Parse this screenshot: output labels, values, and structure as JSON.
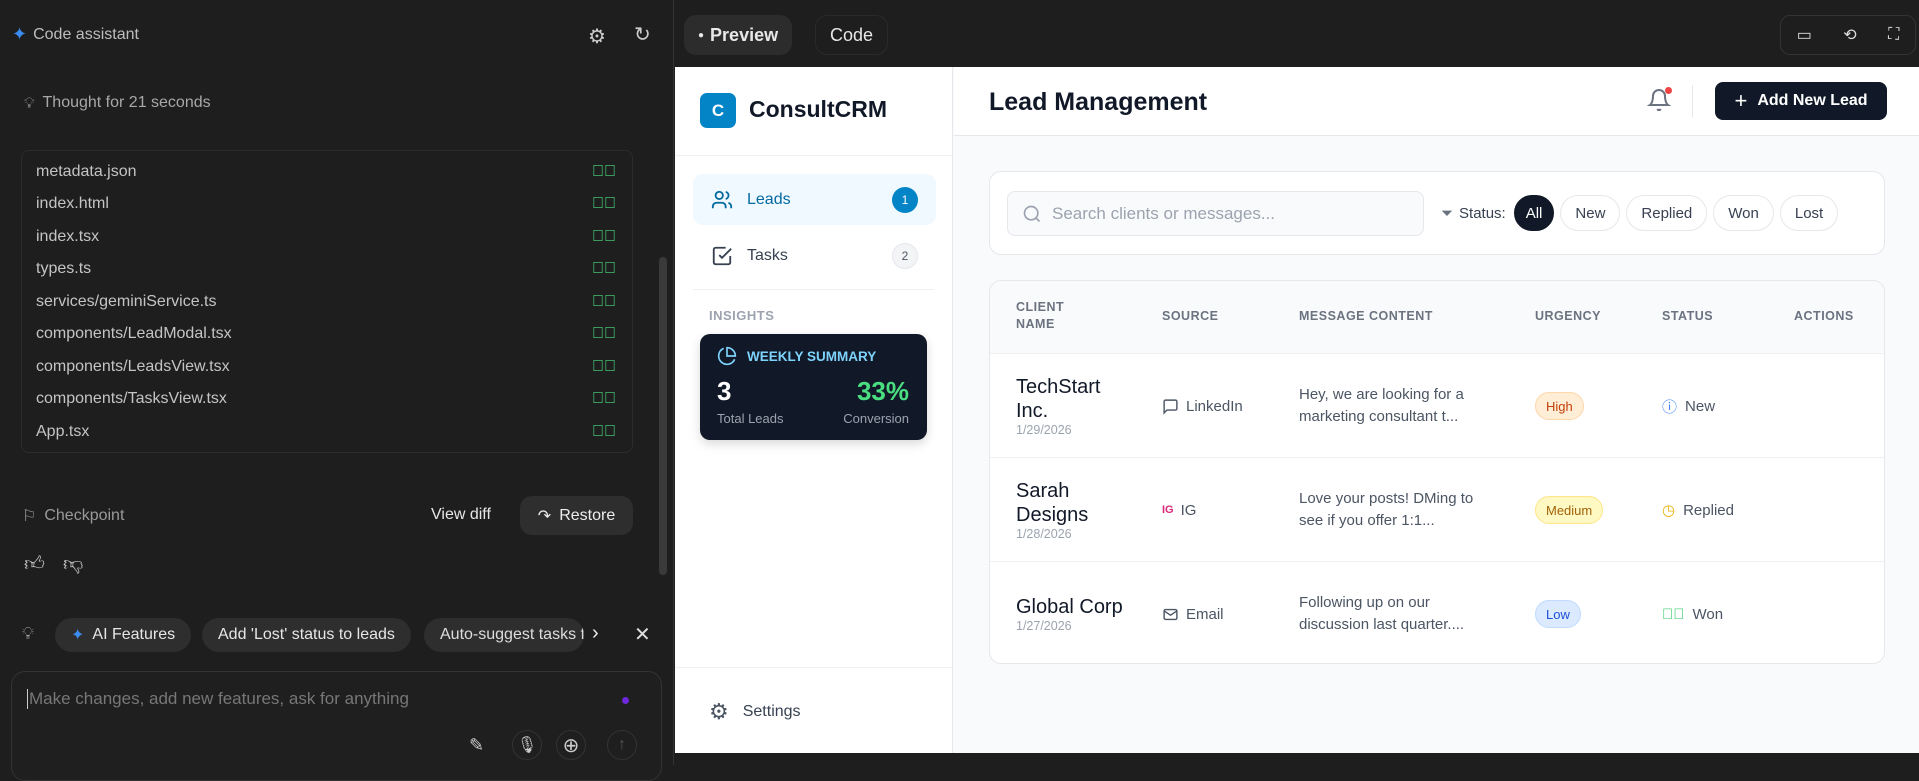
{
  "assistant": {
    "title": "Code assistant",
    "thought": "Thought for 21 seconds",
    "files": [
      "metadata.json",
      "index.html",
      "index.tsx",
      "types.ts",
      "services/geminiService.ts",
      "components/LeadModal.tsx",
      "components/LeadsView.tsx",
      "components/TasksView.tsx",
      "App.tsx"
    ],
    "checkpoint": "Checkpoint",
    "view_diff": "View diff",
    "restore": "Restore",
    "chips": [
      "AI Features",
      "Add 'Lost' status to leads",
      "Auto-suggest tasks f"
    ],
    "input_placeholder": "Make changes, add new features, ask for anything"
  },
  "preview_tabs": {
    "preview": "Preview",
    "code": "Code"
  },
  "app": {
    "logo_letter": "C",
    "name": "ConsultCRM",
    "nav": [
      {
        "label": "Leads",
        "count": "1"
      },
      {
        "label": "Tasks",
        "count": "2"
      }
    ],
    "insights_label": "INSIGHTS",
    "summary": {
      "title": "WEEKLY SUMMARY",
      "total": "3",
      "total_label": "Total Leads",
      "conversion": "33%",
      "conversion_label": "Conversion"
    },
    "settings": "Settings",
    "page_title": "Lead Management",
    "add_button": "Add New Lead",
    "search_placeholder": "Search clients or messages...",
    "status_label": "Status:",
    "filters": [
      "All",
      "New",
      "Replied",
      "Won",
      "Lost"
    ],
    "active_filter": "All",
    "columns": [
      "CLIENT NAME",
      "SOURCE",
      "MESSAGE CONTENT",
      "URGENCY",
      "STATUS",
      "ACTIONS"
    ],
    "leads": [
      {
        "name": "TechStart Inc.",
        "date": "1/29/2026",
        "source": "LinkedIn",
        "message": "Hey, we are looking for a marketing consultant t...",
        "urgency": "High",
        "status": "New"
      },
      {
        "name": "Sarah Designs",
        "date": "1/28/2026",
        "source_icon_text": "IG",
        "source": "IG",
        "message": "Love your posts! DMing to see if you offer 1:1...",
        "urgency": "Medium",
        "status": "Replied"
      },
      {
        "name": "Global Corp",
        "date": "1/27/2026",
        "source": "Email",
        "message": "Following up on our discussion last quarter....",
        "urgency": "Low",
        "status": "Won"
      }
    ]
  },
  "colors": {
    "accent": "#0284c7",
    "dark": "#111827",
    "green": "#4ade80"
  }
}
